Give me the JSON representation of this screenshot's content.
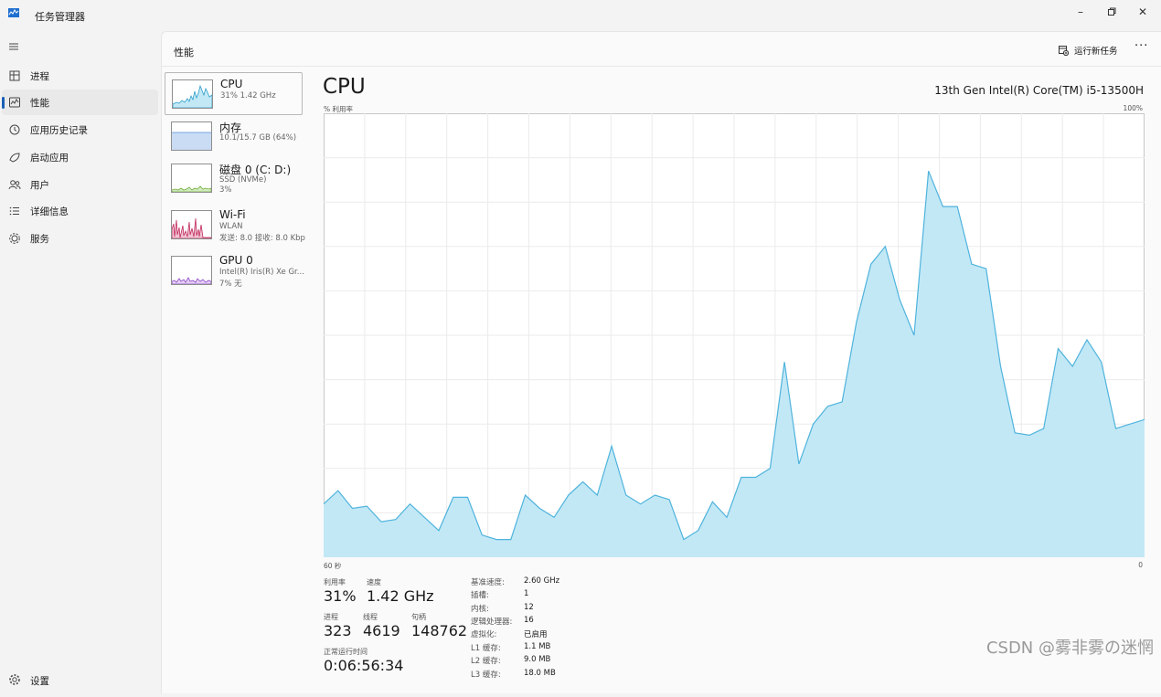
{
  "window": {
    "title": "任务管理器",
    "minimize": "–",
    "maximize": "▢",
    "close": "✕"
  },
  "nav": {
    "items": [
      {
        "label": "进程",
        "icon": "processes-icon"
      },
      {
        "label": "性能",
        "icon": "performance-icon"
      },
      {
        "label": "应用历史记录",
        "icon": "app-history-icon"
      },
      {
        "label": "启动应用",
        "icon": "startup-icon"
      },
      {
        "label": "用户",
        "icon": "users-icon"
      },
      {
        "label": "详细信息",
        "icon": "details-icon"
      },
      {
        "label": "服务",
        "icon": "services-icon"
      }
    ],
    "active_index": 1,
    "settings": "设置"
  },
  "header": {
    "title": "性能",
    "run_new_task": "运行新任务",
    "more": "···"
  },
  "devices": [
    {
      "name": "CPU",
      "line1": "31%  1.42 GHz",
      "line2": "",
      "color": "#2d9ec9"
    },
    {
      "name": "内存",
      "line1": "10.1/15.7 GB (64%)",
      "line2": "",
      "color": "#5b8fd6"
    },
    {
      "name": "磁盘 0 (C: D:)",
      "line1": "SSD (NVMe)",
      "line2": "3%",
      "color": "#6fae3c"
    },
    {
      "name": "Wi-Fi",
      "line1": "WLAN",
      "line2": "发送: 8.0  接收: 8.0 Kbp",
      "color": "#c0285b"
    },
    {
      "name": "GPU 0",
      "line1": "Intel(R) Iris(R) Xe Gr...",
      "line2": "7%  无",
      "color": "#8d46c8"
    }
  ],
  "cpu": {
    "title": "CPU",
    "model": "13th Gen Intel(R) Core(TM) i5-13500H",
    "util_label": "% 利用率",
    "y_max_label": "100%",
    "x_left_label": "60 秒",
    "x_right_label": "0",
    "stats": {
      "util_label": "利用率",
      "util_value": "31%",
      "speed_label": "速度",
      "speed_value": "1.42 GHz",
      "processes_label": "进程",
      "processes_value": "323",
      "threads_label": "线程",
      "threads_value": "4619",
      "handles_label": "句柄",
      "handles_value": "148762",
      "uptime_label": "正常运行时间",
      "uptime_value": "0:06:56:34"
    },
    "specs": [
      {
        "label": "基准速度:",
        "value": "2.60 GHz"
      },
      {
        "label": "插槽:",
        "value": "1"
      },
      {
        "label": "内核:",
        "value": "12"
      },
      {
        "label": "逻辑处理器:",
        "value": "16"
      },
      {
        "label": "虚拟化:",
        "value": "已启用"
      },
      {
        "label": "L1 缓存:",
        "value": "1.1 MB"
      },
      {
        "label": "L2 缓存:",
        "value": "9.0 MB"
      },
      {
        "label": "L3 缓存:",
        "value": "18.0 MB"
      }
    ]
  },
  "chart_data": {
    "type": "area",
    "title": "CPU",
    "ylabel": "% 利用率",
    "ylim": [
      0,
      100
    ],
    "xlabel": "",
    "x_range_label": [
      "60 秒",
      "0"
    ],
    "grid": true,
    "color": "#4fb3dc",
    "fill": "#c2e8f6",
    "series": [
      {
        "values": [
          12,
          15,
          11,
          11.5,
          8,
          8.5,
          12,
          9,
          6,
          13.5,
          13.5,
          5,
          4,
          4,
          14,
          11,
          9,
          14,
          17,
          14,
          25,
          14,
          12,
          14,
          13,
          4,
          6,
          12.5,
          9,
          18,
          18,
          20,
          44,
          21,
          30,
          34,
          35,
          53,
          66,
          70,
          58,
          50,
          87,
          79,
          79,
          66,
          65,
          43,
          28,
          27.5,
          29,
          47,
          43,
          49,
          44,
          29,
          30,
          31
        ]
      }
    ]
  },
  "watermark": "CSDN @雾非雾の迷惘"
}
